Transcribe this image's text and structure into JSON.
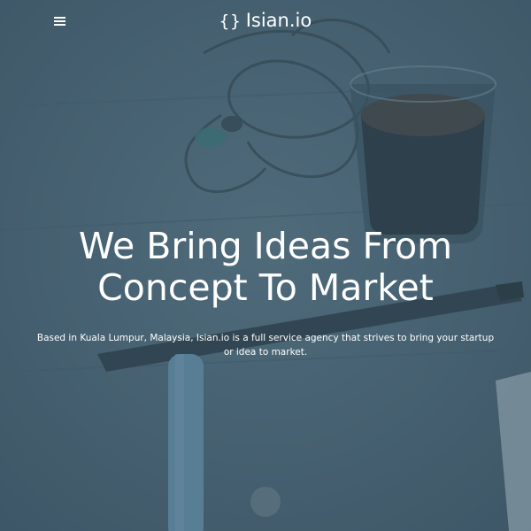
{
  "header": {
    "menu_icon": "hamburger-menu-icon",
    "logo_mark": "{}",
    "brand_name": "Isian.io"
  },
  "hero": {
    "background_image": "desk-with-coffee-glass-earphones-and-pen-photo",
    "overlay_color": "#466272",
    "headline": "We Bring Ideas From Concept To Market",
    "description": "Based in Kuala Lumpur, Malaysia, Isian.io is a full service agency that strives to bring your startup or idea to market.",
    "scroll_icon": "scroll-down-icon"
  }
}
